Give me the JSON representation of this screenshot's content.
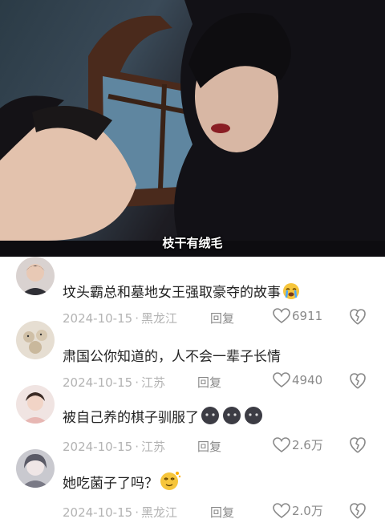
{
  "video": {
    "subtitle": "枝干有绒毛"
  },
  "comments": [
    {
      "text": "坟头霸总和墓地女王强取豪夺的故事",
      "date": "2024-10-15",
      "location": "黑龙江",
      "reply_label": "回复",
      "likes": "6911",
      "emoji": "crying-face"
    },
    {
      "text": "肃国公你知道的，人不会一辈子长情",
      "date": "2024-10-15",
      "location": "江苏",
      "reply_label": "回复",
      "likes": "4940",
      "emoji": ""
    },
    {
      "text": "被自己养的棋子驯服了",
      "date": "2024-10-15",
      "location": "江苏",
      "reply_label": "回复",
      "likes": "2.6万",
      "emoji": "dark-blob-x3"
    },
    {
      "text": "她吃菌子了吗？",
      "date": "2024-10-15",
      "location": "黑龙江",
      "reply_label": "回复",
      "likes": "2.0万",
      "emoji": "dizzy-face"
    }
  ],
  "colors": {
    "meta_gray": "#b3b3b3",
    "text_dark": "#222222"
  }
}
